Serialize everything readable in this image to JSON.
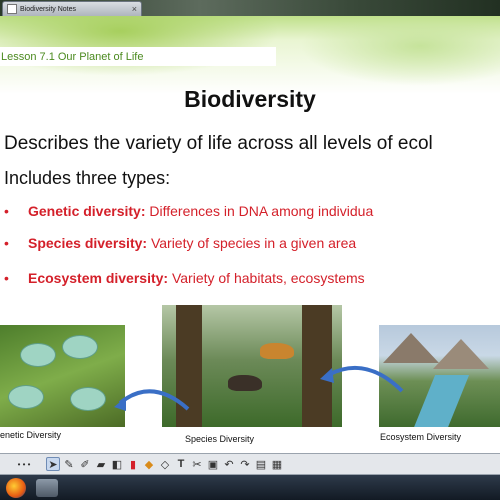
{
  "window": {
    "tab_title": "Biodiversity Notes",
    "close_glyph": "×"
  },
  "slide": {
    "lesson_title": "Lesson 7.1 Our Planet of Life",
    "heading": "Biodiversity",
    "line1": "Describes the variety of life across all levels of ecol",
    "line2": "Includes three types:",
    "bullets": [
      {
        "dot": "•",
        "term": "Genetic diversity:",
        "text": " Differences in DNA among individua"
      },
      {
        "dot": "•",
        "term": "Species diversity:",
        "text": " Variety of species in a given area"
      },
      {
        "dot": "•",
        "term": "Ecosystem diversity:",
        "text": " Variety of habitats, ecosystems"
      }
    ],
    "captions": {
      "genetic": "enetic Diversity",
      "species": "Species Diversity",
      "ecosystem": "Ecosystem Diversity"
    }
  },
  "toolbar": {
    "tools": [
      "dots-icon",
      "pointer-icon",
      "pen-icon",
      "brush-icon",
      "highlighter-icon",
      "eraser-icon",
      "marker-icon",
      "fill-icon",
      "shape-icon",
      "text-icon",
      "magic-pen-icon",
      "screen-shade-icon",
      "undo-icon",
      "redo-icon",
      "page-icon",
      "more-icon"
    ],
    "glyphs": {
      "dots": "• • •",
      "pointer": "➤",
      "pen": "✎",
      "brush": "✐",
      "highlighter": "▰",
      "eraser": "◧",
      "marker": "▮",
      "fill": "◆",
      "shape": "◇",
      "text": "T",
      "magic": "✂",
      "shade": "▣",
      "undo": "↶",
      "redo": "↷",
      "page": "▤",
      "more": "▦"
    }
  },
  "colors": {
    "lesson_green": "#4b8a1f",
    "bullet_red": "#d4202a",
    "arrow_blue": "#3a6fc6"
  }
}
